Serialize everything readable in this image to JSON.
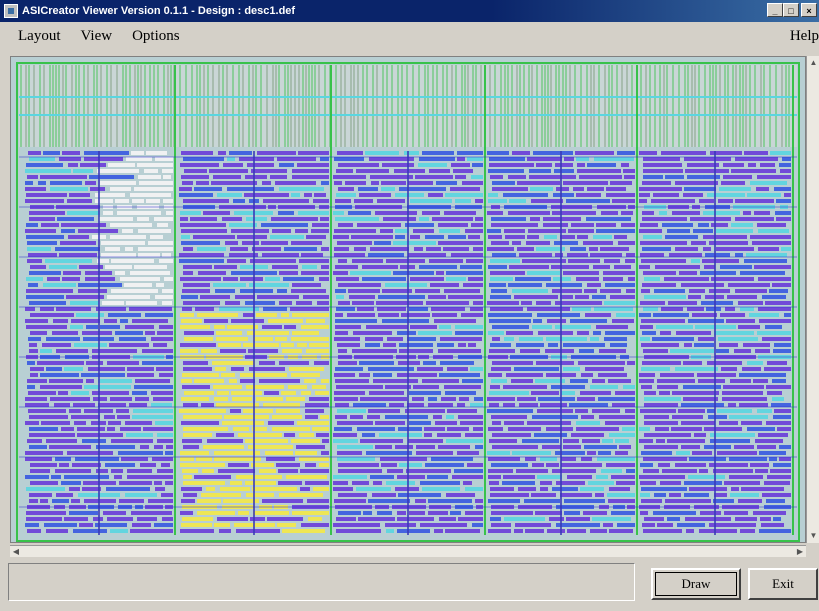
{
  "window": {
    "title": "ASICreator Viewer  Version 0.1.1  -  Design : desc1.def",
    "controls": {
      "minimize": "_",
      "maximize": "□",
      "close": "×"
    }
  },
  "menu": {
    "items": [
      {
        "label": "Layout",
        "icon": ""
      },
      {
        "label": "View",
        "icon": ""
      },
      {
        "label": "Options",
        "icon": ""
      }
    ],
    "help": "Help"
  },
  "buttons": {
    "draw": "Draw",
    "exit": "Exit"
  },
  "status": {
    "text": ""
  },
  "colors": {
    "cell_purple": "#6a3fd8",
    "cell_blue": "#3a5be0",
    "highlight_yellow": "#f2e84a",
    "highlight_white": "#f4f4f4",
    "routing_green": "#38c24a",
    "routing_cyan": "#5ad6e0",
    "background": "#b8cfd3"
  }
}
